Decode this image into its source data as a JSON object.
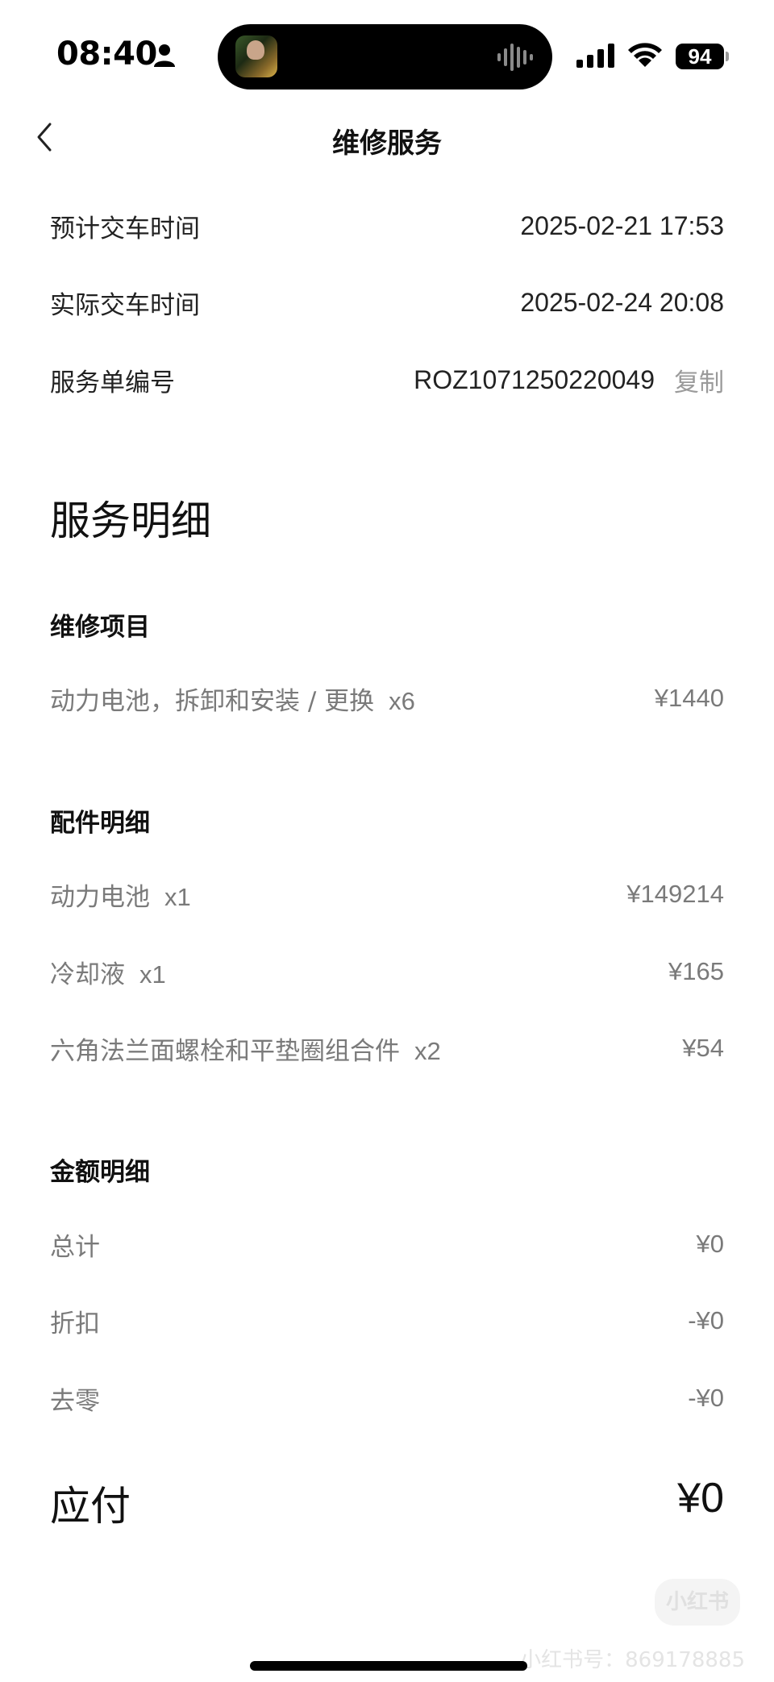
{
  "status_bar": {
    "time": "08:40",
    "battery": "94"
  },
  "nav": {
    "title": "维修服务"
  },
  "info": {
    "expected_delivery": {
      "label": "预计交车时间",
      "value": "2025-02-21 17:53"
    },
    "actual_delivery": {
      "label": "实际交车时间",
      "value": "2025-02-24 20:08"
    },
    "order_no": {
      "label": "服务单编号",
      "value": "ROZ1071250220049",
      "copy_label": "复制"
    }
  },
  "details": {
    "title": "服务明细",
    "repair": {
      "title": "维修项目",
      "items": [
        {
          "name": "动力电池，拆卸和安装 / 更换",
          "qty": "x6",
          "price": "¥1440"
        }
      ]
    },
    "parts": {
      "title": "配件明细",
      "items": [
        {
          "name": "动力电池",
          "qty": "x1",
          "price": "¥149214"
        },
        {
          "name": "冷却液",
          "qty": "x1",
          "price": "¥165"
        },
        {
          "name": "六角法兰面螺栓和平垫圈组合件",
          "qty": "x2",
          "price": "¥54"
        }
      ]
    },
    "amount": {
      "title": "金额明细",
      "items": [
        {
          "name": "总计",
          "price": "¥0"
        },
        {
          "name": "折扣",
          "price": "-¥0"
        },
        {
          "name": "去零",
          "price": "-¥0"
        }
      ]
    }
  },
  "payable": {
    "label": "应付",
    "value": "¥0"
  },
  "watermark": {
    "logo": "小红书",
    "text": "小红书号：869178885"
  }
}
